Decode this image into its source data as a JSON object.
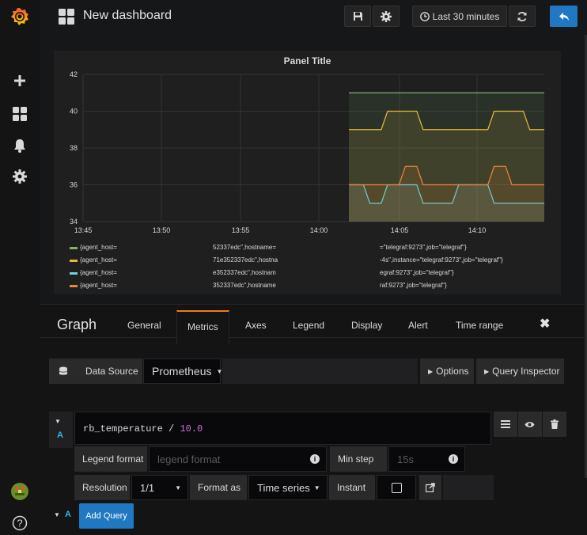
{
  "navbar": {
    "title": "New dashboard",
    "time_picker": "Last 30 minutes"
  },
  "panel": {
    "title": "Panel Title"
  },
  "chart_data": {
    "type": "line",
    "x": [
      "13:45",
      "13:50",
      "13:55",
      "14:00",
      "14:05",
      "14:10"
    ],
    "yticks": [
      "42",
      "40",
      "38",
      "36",
      "34"
    ],
    "ylim": [
      34,
      42
    ],
    "grid": true,
    "legend_position": "bottom",
    "series": [
      {
        "color": "#7eb26d",
        "values": [
          41,
          41,
          41,
          41,
          41,
          41,
          41,
          41,
          41,
          41,
          41
        ]
      },
      {
        "color": "#eab839",
        "values": [
          39,
          39,
          40,
          40,
          39,
          39,
          39,
          39,
          40,
          40,
          39
        ]
      },
      {
        "color": "#6ed0e0",
        "values": [
          36,
          35,
          36,
          36,
          35,
          35,
          36,
          36,
          35,
          35,
          35
        ]
      },
      {
        "color": "#ef843c",
        "values": [
          36,
          36,
          36,
          37,
          36,
          36,
          36,
          36,
          37,
          36,
          36
        ]
      }
    ]
  },
  "legend": [
    {
      "color": "#7eb26d",
      "left": "{agent_host=",
      "mid": "52337edc\",hostname=",
      "right": "=\"telegraf:9273\",job=\"telegraf\"}"
    },
    {
      "color": "#eab839",
      "left": "{agent_host=",
      "mid": "71e352337edc\",hostna",
      "right": "-4s\",instance=\"telegraf:9273\",job=\"telegraf\"}"
    },
    {
      "color": "#6ed0e0",
      "left": "{agent_host=",
      "mid": "e352337edc\",hostnam",
      "right": "egraf:9273\",job=\"telegraf\"}"
    },
    {
      "color": "#ef843c",
      "left": "{agent_host=",
      "mid": "352337edc\",hostname",
      "right": "raf:9273\",job=\"telegraf\"}"
    }
  ],
  "editor": {
    "heading": "Graph",
    "tabs": [
      "General",
      "Metrics",
      "Axes",
      "Legend",
      "Display",
      "Alert",
      "Time range"
    ],
    "active_tab": "Metrics",
    "datasource_label": "Data Source",
    "datasource_value": "Prometheus",
    "options_label": "Options",
    "query_inspector_label": "Query Inspector",
    "query_letter": "A",
    "query_expr": "rb_temperature",
    "query_op": "/",
    "query_num": "10.0",
    "legend_format_label": "Legend format",
    "legend_format_placeholder": "legend format",
    "min_step_label": "Min step",
    "min_step_placeholder": "15s",
    "resolution_label": "Resolution",
    "resolution_value": "1/1",
    "format_as_label": "Format as",
    "format_as_value": "Time series",
    "instant_label": "Instant",
    "add_query_label": "Add Query"
  }
}
